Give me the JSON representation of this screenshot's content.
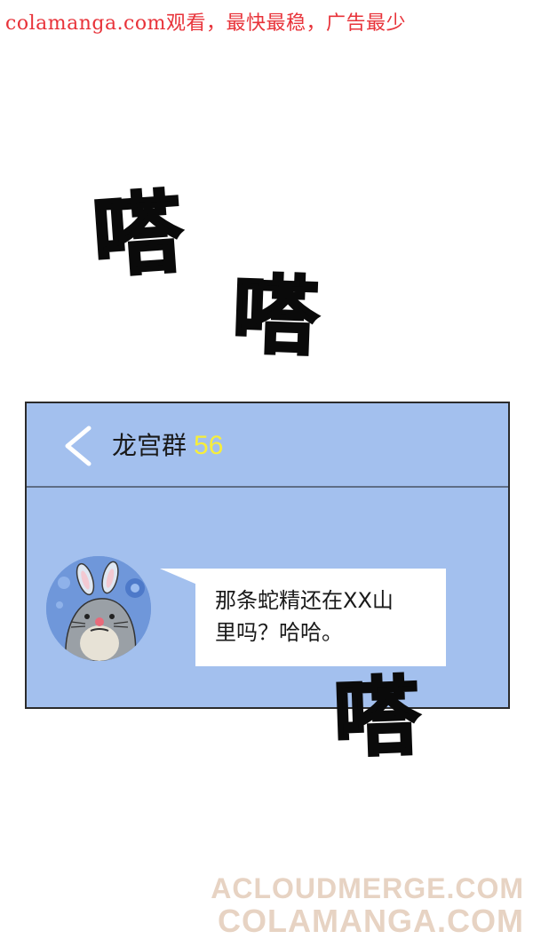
{
  "watermark_top": "colamanga.com观看，最快最稳，广告最少",
  "sfx": [
    "嗒",
    "嗒",
    "嗒"
  ],
  "chat": {
    "group_name": "龙宫群",
    "member_count": "56",
    "message_lines": [
      "那条蛇精还在XX山",
      "里吗？哈哈。"
    ]
  },
  "watermark_bottom": [
    "ACLOUDMERGE.COM",
    "COLAMANGA.COM"
  ],
  "colors": {
    "chat_background": "#a3c0ee",
    "member_count": "#f7ee3a",
    "watermark_top": "#e8333a"
  },
  "icons": [
    "chevron-left-icon",
    "rabbit-seal-avatar"
  ]
}
